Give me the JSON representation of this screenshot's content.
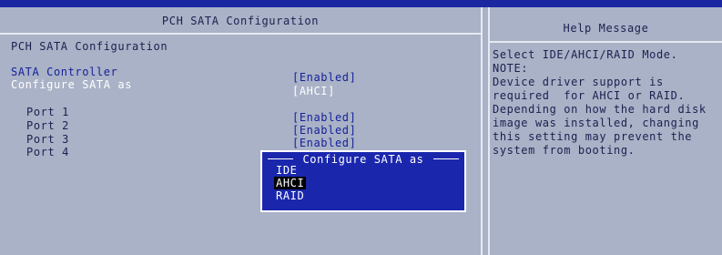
{
  "header": {
    "title": "PCH SATA Configuration",
    "help_title": "Help Message"
  },
  "section_title": "PCH SATA Configuration",
  "settings": [
    {
      "label": "SATA Controller",
      "value": "[Enabled]"
    },
    {
      "label": "Configure SATA as",
      "value": "[AHCI]"
    }
  ],
  "ports": [
    {
      "label": "Port 1",
      "value": "[Enabled]"
    },
    {
      "label": "Port 2",
      "value": "[Enabled]"
    },
    {
      "label": "Port 3",
      "value": "[Enabled]"
    },
    {
      "label": "Port 4",
      "value": ""
    }
  ],
  "popup": {
    "title": "Configure SATA as",
    "options": [
      "IDE",
      "AHCI",
      "RAID"
    ],
    "selected": "AHCI"
  },
  "help": {
    "lines": [
      "Select IDE/AHCI/RAID Mode.",
      "NOTE:",
      "Device driver support is",
      "required  for AHCI or RAID.",
      "Depending on how the hard disk",
      "image was installed, changing",
      "this setting may prevent the",
      "system from booting."
    ]
  },
  "colors": {
    "background": "#a9b2c6",
    "popup_background": "#1a27ad",
    "highlight_text": "#ffffff",
    "selected_option_background": "#000000"
  }
}
